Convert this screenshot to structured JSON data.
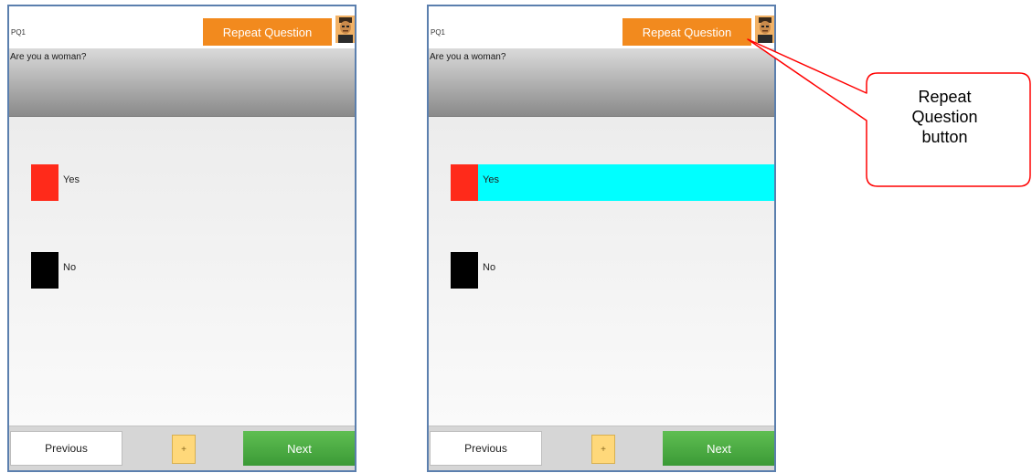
{
  "screens": {
    "left": {
      "question_id": "PQ1",
      "repeat_label": "Repeat Question",
      "question": "Are you a woman?",
      "options": [
        {
          "label": "Yes",
          "color": "#ff2a1a",
          "selected": false
        },
        {
          "label": "No",
          "color": "#000000",
          "selected": false
        }
      ],
      "prev_label": "Previous",
      "mid_label": "+",
      "next_label": "Next"
    },
    "right": {
      "question_id": "PQ1",
      "repeat_label": "Repeat Question",
      "question": "Are you a woman?",
      "options": [
        {
          "label": "Yes",
          "color": "#ff2a1a",
          "selected": true,
          "highlight": "#00ffff"
        },
        {
          "label": "No",
          "color": "#000000",
          "selected": false
        }
      ],
      "prev_label": "Previous",
      "mid_label": "+",
      "next_label": "Next"
    }
  },
  "callout": {
    "text": "Repeat Question button",
    "line1": "Repeat",
    "line2": "Question",
    "line3": "button",
    "border_color": "#ff0000"
  },
  "colors": {
    "repeat_button": "#f28a1e",
    "next_button": "#3b9a36",
    "frame": "#5b7fae"
  },
  "icons": {
    "avatar": "user-avatar-icon"
  }
}
